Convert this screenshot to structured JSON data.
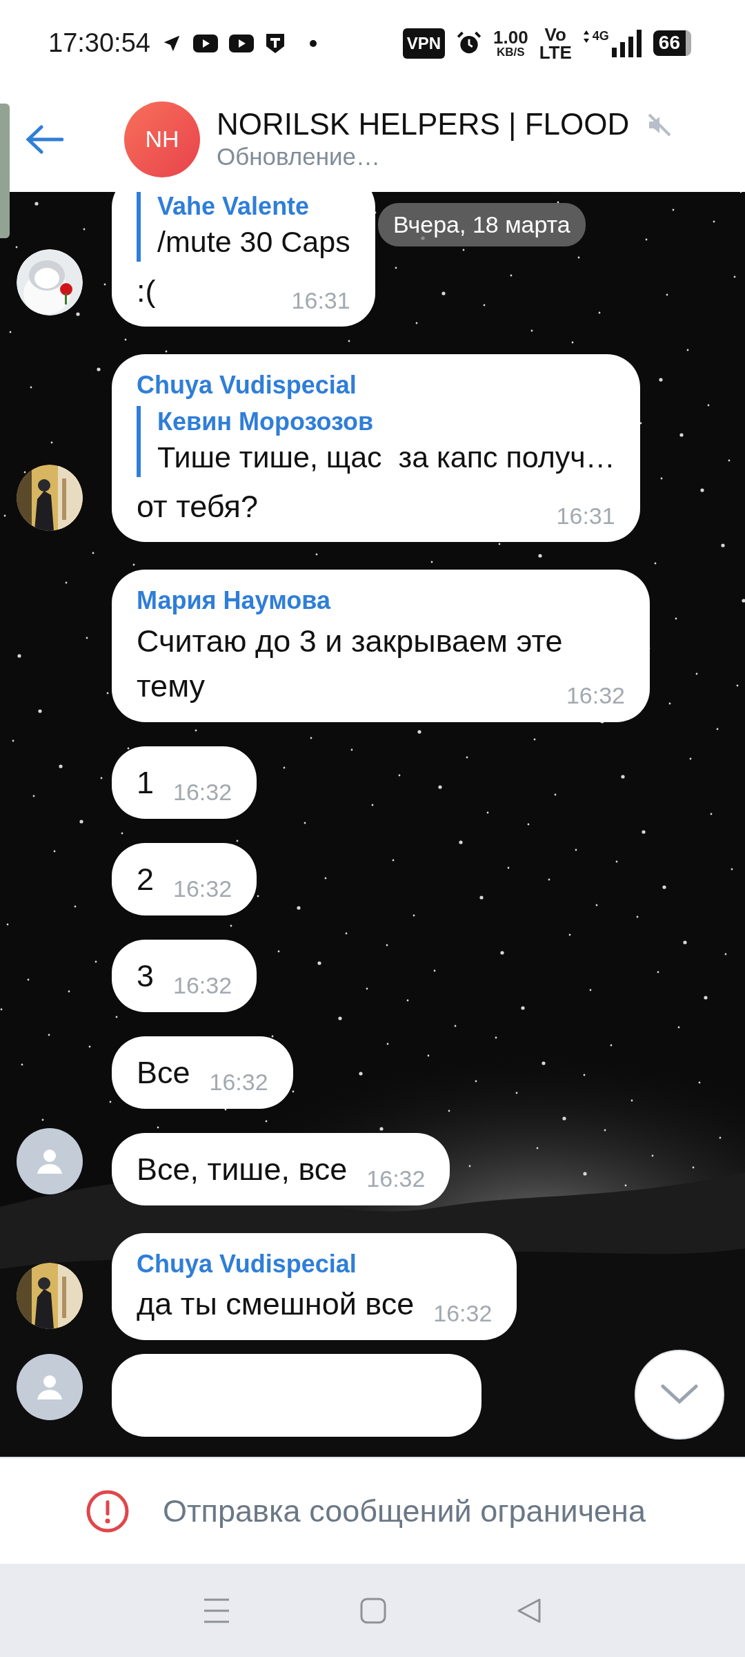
{
  "status_bar": {
    "time": "17:30:54",
    "vpn": "VPN",
    "speed_value": "1.00",
    "speed_unit": "KB/S",
    "volte_top": "Vo",
    "volte_bottom": "LTE",
    "network": "4G",
    "battery": "66"
  },
  "header": {
    "avatar_initials": "NH",
    "title": "NORILSK HELPERS | FLOOD",
    "muted": true,
    "subtitle": "Обновление…"
  },
  "date_pill": "Вчера, 18 марта",
  "messages": [
    {
      "kind": "message",
      "reply": {
        "name": "Vahe Valente",
        "text": "/mute 30 Caps"
      },
      "text": ":(",
      "time": "16:31"
    },
    {
      "kind": "message",
      "sender": "Chuya Vudispecial",
      "reply": {
        "name": "Кевин Морозозов",
        "text": "Тише тише, щас  за капс получ…"
      },
      "text": "от тебя?",
      "time": "16:31"
    },
    {
      "kind": "message",
      "sender": "Мария Наумова",
      "text": "Считаю до 3 и закрываем эте тему",
      "time": "16:32"
    },
    {
      "kind": "message",
      "text": "1",
      "time": "16:32"
    },
    {
      "kind": "message",
      "text": "2",
      "time": "16:32"
    },
    {
      "kind": "message",
      "text": "3",
      "time": "16:32"
    },
    {
      "kind": "message",
      "text": "Все",
      "time": "16:32"
    },
    {
      "kind": "message",
      "avatar": {
        "kind": "silhouette"
      },
      "text": "Все, тише, все",
      "time": "16:32"
    },
    {
      "kind": "message",
      "sender": "Chuya Vudispecial",
      "text": "да ты смешной все",
      "time": "16:32"
    },
    {
      "kind": "partial",
      "avatar": {
        "kind": "silhouette"
      }
    }
  ],
  "restriction": "Отправка сообщений ограничена"
}
